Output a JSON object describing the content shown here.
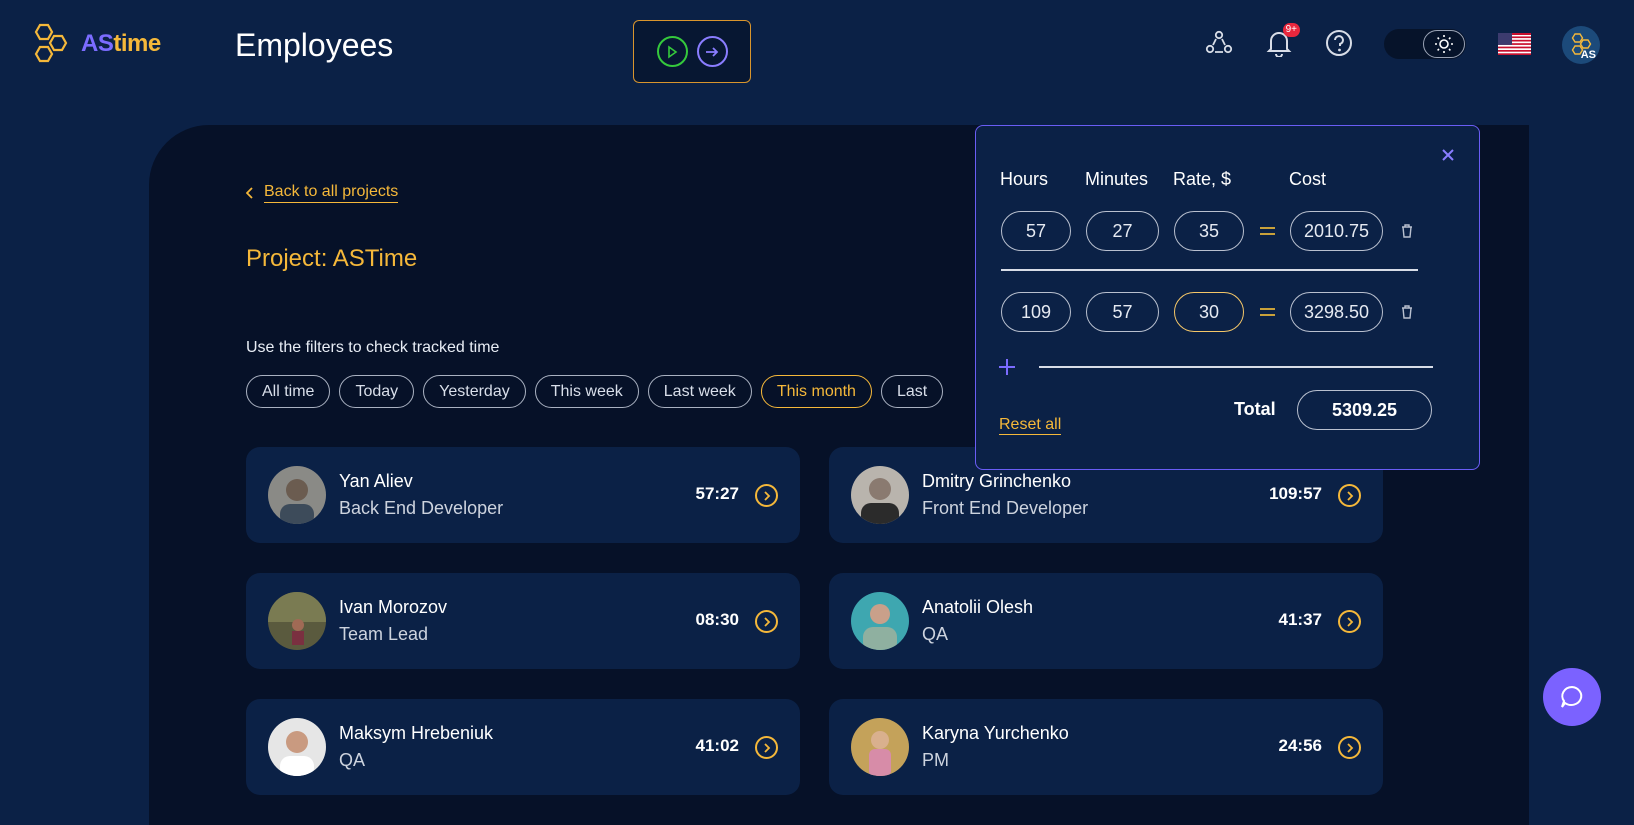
{
  "app": {
    "logo_prefix": "AS",
    "logo_suffix": "time",
    "page_title": "Employees"
  },
  "header": {
    "notifications_count": "9+",
    "user_initials": "AS",
    "icons": [
      "team-icon",
      "bell-icon",
      "help-icon",
      "sun-icon",
      "us-flag-icon",
      "avatar"
    ]
  },
  "main": {
    "back_label": "Back to all projects",
    "project_title": "Project: ASTime",
    "filter_hint": "Use the filters to check tracked time",
    "filters": [
      {
        "label": "All time",
        "active": false
      },
      {
        "label": "Today",
        "active": false
      },
      {
        "label": "Yesterday",
        "active": false
      },
      {
        "label": "This week",
        "active": false
      },
      {
        "label": "Last week",
        "active": false
      },
      {
        "label": "This month",
        "active": true
      },
      {
        "label": "Last",
        "active": false
      }
    ],
    "employees": [
      {
        "name": "Yan Aliev",
        "role": "Back End Developer",
        "time": "57:27",
        "avatar_color": "#6b5c50"
      },
      {
        "name": "Dmitry Grinchenko",
        "role": "Front End Developer",
        "time": "109:57",
        "avatar_color": "#8a7a70"
      },
      {
        "name": "Ivan Morozov",
        "role": "Team Lead",
        "time": "08:30",
        "avatar_color": "#5a5a3e"
      },
      {
        "name": "Anatolii Olesh",
        "role": "QA",
        "time": "41:37",
        "avatar_color": "#3ea7b0"
      },
      {
        "name": "Maksym Hrebeniuk",
        "role": "QA",
        "time": "41:02",
        "avatar_color": "#d8d8d8"
      },
      {
        "name": "Karyna Yurchenko",
        "role": "PM",
        "time": "24:56",
        "avatar_color": "#c89a70"
      }
    ]
  },
  "calculator": {
    "headers": {
      "hours": "Hours",
      "minutes": "Minutes",
      "rate": "Rate, $",
      "cost": "Cost"
    },
    "rows": [
      {
        "hours": "57",
        "minutes": "27",
        "rate": "35",
        "cost": "2010.75"
      },
      {
        "hours": "109",
        "minutes": "57",
        "rate": "30",
        "cost": "3298.50"
      }
    ],
    "reset_label": "Reset all",
    "total_label": "Total",
    "total_value": "5309.25"
  },
  "colors": {
    "accent": "#f5b83a",
    "brand_purple": "#7b6cff",
    "background": "#0b2146",
    "panel": "#061128"
  }
}
